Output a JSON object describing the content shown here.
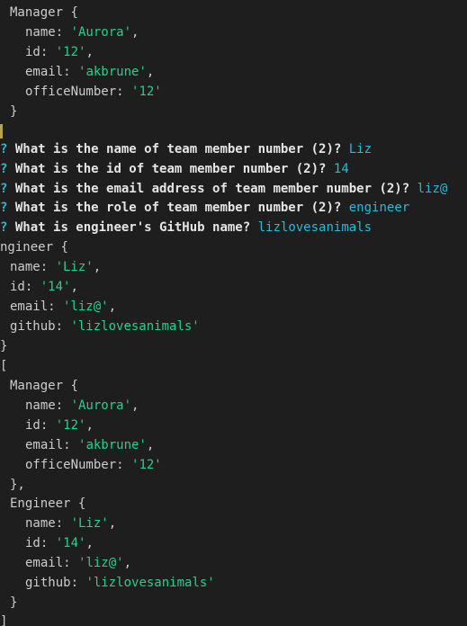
{
  "terminal": {
    "manager_block_1": {
      "class_name": "Manager",
      "fields": [
        {
          "key": "name",
          "value": "'Aurora'",
          "trail": ","
        },
        {
          "key": "id",
          "value": "'12'",
          "trail": ","
        },
        {
          "key": "email",
          "value": "'akbrune'",
          "trail": ","
        },
        {
          "key": "officeNumber",
          "value": "'12'",
          "trail": ""
        }
      ]
    },
    "prompts": [
      {
        "mark": "?",
        "question": "What is the name of team member number (2)?",
        "answer": "Liz"
      },
      {
        "mark": "?",
        "question": "What is the id of team member number (2)?",
        "answer": "14"
      },
      {
        "mark": "?",
        "question": "What is the email address of team member number (2)?",
        "answer": "liz@"
      },
      {
        "mark": "?",
        "question": "What is the role of team member number (2)?",
        "answer": "engineer"
      },
      {
        "mark": "?",
        "question": "What is engineer's GitHub name?",
        "answer": "lizlovesanimals"
      }
    ],
    "engineer_block_1": {
      "class_name": "ngineer",
      "fields": [
        {
          "key": "name",
          "value": "'Liz'",
          "trail": ","
        },
        {
          "key": "id",
          "value": "'14'",
          "trail": ","
        },
        {
          "key": "email",
          "value": "'liz@'",
          "trail": ","
        },
        {
          "key": "github",
          "value": "'lizlovesanimals'",
          "trail": ""
        }
      ]
    },
    "array_output": {
      "manager": {
        "class_name": "Manager",
        "fields": [
          {
            "key": "name",
            "value": "'Aurora'",
            "trail": ","
          },
          {
            "key": "id",
            "value": "'12'",
            "trail": ","
          },
          {
            "key": "email",
            "value": "'akbrune'",
            "trail": ","
          },
          {
            "key": "officeNumber",
            "value": "'12'",
            "trail": ""
          }
        ],
        "close": "},"
      },
      "engineer": {
        "class_name": "Engineer",
        "fields": [
          {
            "key": "name",
            "value": "'Liz'",
            "trail": ","
          },
          {
            "key": "id",
            "value": "'14'",
            "trail": ","
          },
          {
            "key": "email",
            "value": "'liz@'",
            "trail": ","
          },
          {
            "key": "github",
            "value": "'lizlovesanimals'",
            "trail": ""
          }
        ],
        "close": "}"
      }
    },
    "colors": {
      "background": "#1e1e1e",
      "string": "#23d18b",
      "answer": "#29b8db",
      "prompt_mark": "#2fb6c8"
    }
  }
}
